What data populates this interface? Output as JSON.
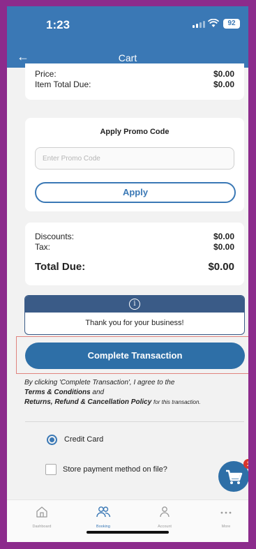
{
  "status_bar": {
    "time": "1:23",
    "battery": "92"
  },
  "nav": {
    "title": "Cart"
  },
  "summary": {
    "price_label": "Price:",
    "price_value": "$0.00",
    "item_total_label": "Item Total Due:",
    "item_total_value": "$0.00"
  },
  "promo": {
    "title": "Apply Promo Code",
    "placeholder": "Enter Promo Code",
    "apply_label": "Apply"
  },
  "totals": {
    "discounts_label": "Discounts:",
    "discounts_value": "$0.00",
    "tax_label": "Tax:",
    "tax_value": "$0.00",
    "total_label": "Total Due:",
    "total_value": "$0.00"
  },
  "info": {
    "icon": "i",
    "message": "Thank you for your business!"
  },
  "complete_label": "Complete Transaction",
  "legal": {
    "line1": "By clicking 'Complete Transaction', I agree to the",
    "terms": "Terms & Conditions",
    "and": "and",
    "policy": "Returns, Refund & Cancellation Policy",
    "suffix": "for this transaction."
  },
  "payment": {
    "credit_card": "Credit Card",
    "store_method": "Store payment method on file?"
  },
  "cart_badge": "1",
  "tabs": [
    {
      "label": "Dashboard"
    },
    {
      "label": "Booking"
    },
    {
      "label": "Account"
    },
    {
      "label": "More"
    }
  ],
  "colors": {
    "primary": "#3a78b5",
    "button": "#2e6fa7",
    "info_header": "#3a5b87",
    "badge": "#d9342b",
    "frame": "#8c2b8c"
  }
}
